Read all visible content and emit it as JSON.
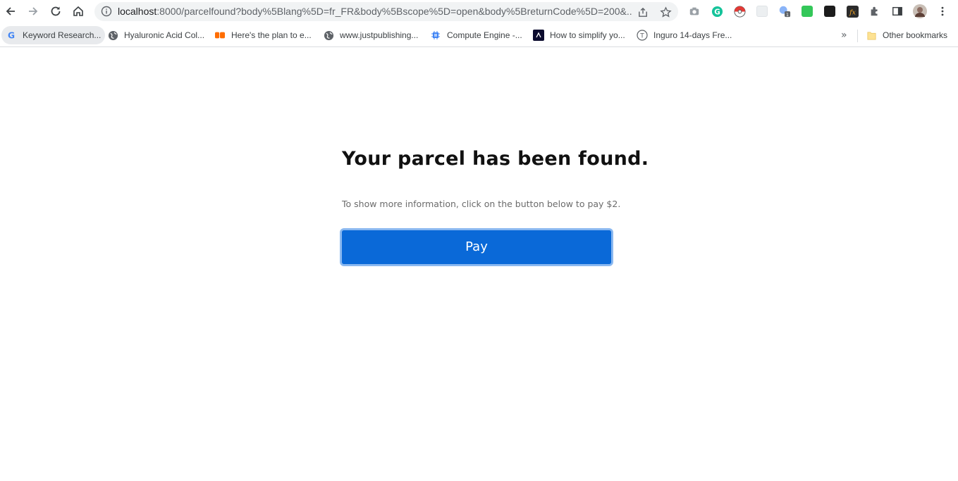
{
  "browser": {
    "url_host": "localhost",
    "url_rest": ":8000/parcelfound?body%5Blang%5D=fr_FR&body%5Bscope%5D=open&body%5BreturnCode%5D=200&..."
  },
  "bookmarks": [
    {
      "label": "Keyword Research...",
      "icon": "google-icon"
    },
    {
      "label": "Hyaluronic Acid Col...",
      "icon": "globe-icon"
    },
    {
      "label": "Here's the plan to e...",
      "icon": "orange-logo-icon"
    },
    {
      "label": "www.justpublishing...",
      "icon": "globe-icon"
    },
    {
      "label": "Compute Engine -...",
      "icon": "chip-icon"
    },
    {
      "label": "How to simplify yo...",
      "icon": "dark-logo-icon"
    },
    {
      "label": "Inguro 14-days Fre...",
      "icon": "letter-t-icon"
    }
  ],
  "bookmarks_more": "»",
  "other_bookmarks": "Other bookmarks",
  "page": {
    "title": "Your parcel has been found.",
    "subtitle": "To show more information, click on the button below to pay $2.",
    "pay_label": "Pay"
  },
  "colors": {
    "pay_button": "#0a69d8",
    "pay_border": "#8ab8f0"
  }
}
